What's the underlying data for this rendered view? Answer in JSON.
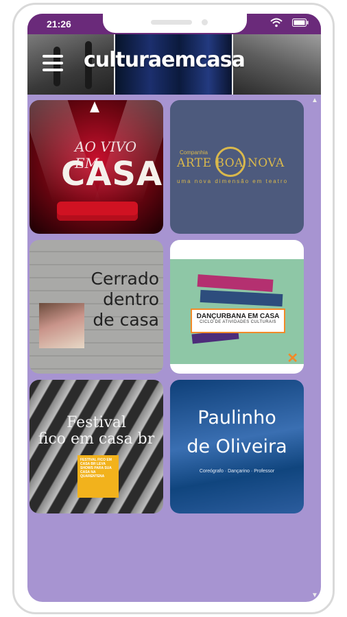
{
  "status_bar": {
    "time": "21:26"
  },
  "header": {
    "brand": "culturaemcasa"
  },
  "tiles": [
    {
      "name": "Ao Vivo Em Casa",
      "line1": "AO VIVO",
      "line2": "EM",
      "line3": "CASA"
    },
    {
      "name": "Companhia Arte Boa Nova",
      "small": "Companhia",
      "title": "ARTE BOA NOVA",
      "subtitle": "uma nova dimensão em teatro"
    },
    {
      "name": "Cerrado dentro de casa",
      "line1": "Cerrado",
      "line2": "dentro",
      "line3": "de casa"
    },
    {
      "name": "Dançurbana em Casa",
      "title": "DANÇURBANA EM CASA",
      "subtitle": "CICLO DE ATIVIDADES CULTURAIS"
    },
    {
      "name": "Festival fico em casa br",
      "line1": "Festival",
      "line2": "fico em casa br",
      "poster": "FESTIVAL FICO EM CASA BR LEVA SHOWS PARA SUA CASA NA QUARENTENA"
    },
    {
      "name": "Paulinho de Oliveira",
      "line1": "Paulinho",
      "line2": "de Oliveira",
      "subtitle": "Coreógrafo · Dançarino · Professor"
    }
  ],
  "colors": {
    "status_bar": "#6a2a7a",
    "background": "#a794d1"
  },
  "icons": [
    "menu-icon",
    "wifi-icon",
    "battery-icon",
    "scroll-up-icon",
    "scroll-down-icon"
  ]
}
